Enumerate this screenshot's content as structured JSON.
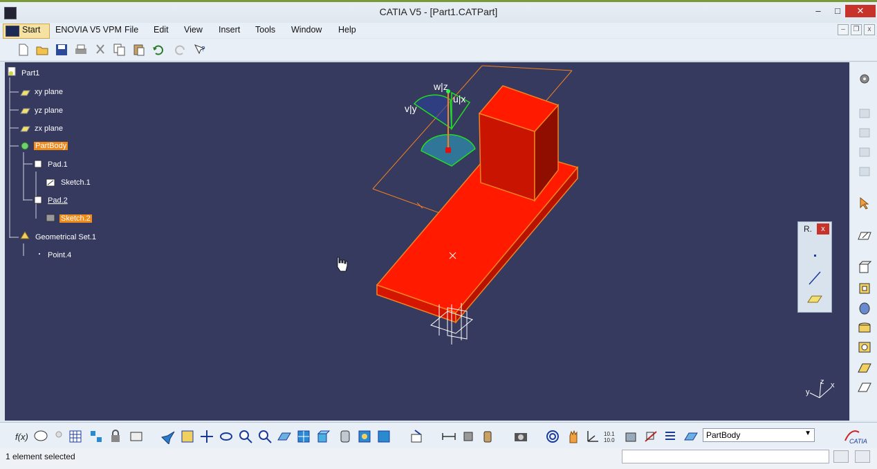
{
  "window": {
    "title": "CATIA V5 - [Part1.CATPart]",
    "minimize": "–",
    "maximize": "□",
    "close": "✕"
  },
  "menubar": {
    "items": [
      "Start",
      "ENOVIA V5 VPM",
      "File",
      "Edit",
      "View",
      "Insert",
      "Tools",
      "Window",
      "Help"
    ]
  },
  "tree": {
    "nodes": [
      {
        "label": "Part1",
        "icon": "part-icon"
      },
      {
        "label": "xy plane",
        "icon": "plane-icon"
      },
      {
        "label": "yz plane",
        "icon": "plane-icon"
      },
      {
        "label": "zx plane",
        "icon": "plane-icon"
      },
      {
        "label": "PartBody",
        "icon": "body-icon"
      },
      {
        "label": "Pad.1",
        "icon": "pad-icon"
      },
      {
        "label": "Sketch.1",
        "icon": "sketch-icon"
      },
      {
        "label": "Pad.2",
        "icon": "pad-icon"
      },
      {
        "label": "Sketch.2",
        "icon": "sketch-icon"
      },
      {
        "label": "Geometrical Set.1",
        "icon": "geoset-icon"
      },
      {
        "label": "Point.4",
        "icon": "point-icon"
      }
    ]
  },
  "compass": {
    "w_z": "w|z",
    "u_x": "u|x",
    "v_y": "v|y"
  },
  "axis_labels": {
    "x": "x",
    "y": "y",
    "z": "z"
  },
  "palette": {
    "title": "R.",
    "close": "x"
  },
  "bottom": {
    "current_body": "PartBody"
  },
  "status": {
    "message": "1 element selected"
  },
  "colors": {
    "viewport_bg": "#363a5e",
    "part_red": "#ff1a00",
    "edge_orange": "#f58220",
    "highlight": "#f08a1a"
  }
}
